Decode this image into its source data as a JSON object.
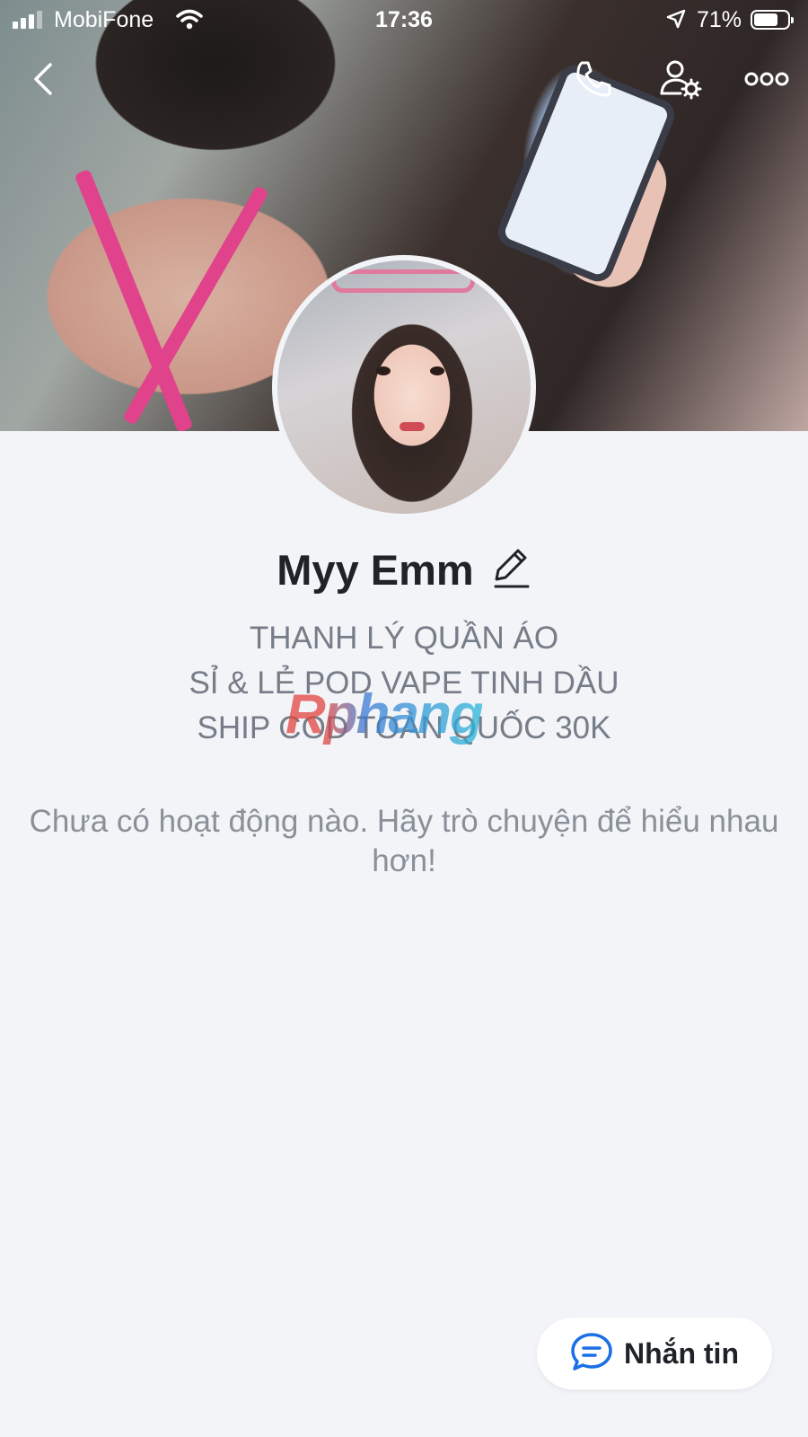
{
  "status_bar": {
    "carrier": "MobiFone",
    "time": "17:36",
    "battery": "71%",
    "battery_level": 0.71
  },
  "nav": {
    "back_icon": "chevron-left-icon",
    "call_icon": "phone-icon",
    "settings_icon": "user-settings-icon",
    "more_icon": "more-horizontal-icon"
  },
  "profile": {
    "name": "Myy Emm",
    "bio": [
      "THANH LÝ QUẦN ÁO",
      "SỈ & LẺ POD VAPE TINH DẦU",
      "SHIP COD TOÀN QUỐC 30K"
    ],
    "empty_activity": "Chưa có hoạt động nào. Hãy trò chuyện để hiểu nhau hơn!"
  },
  "watermark": "Rphang",
  "actions": {
    "message_label": "Nhắn tin",
    "message_icon": "chat-bubble-icon"
  },
  "colors": {
    "background": "#f2f4f7",
    "message_icon": "#1a6fe6"
  }
}
